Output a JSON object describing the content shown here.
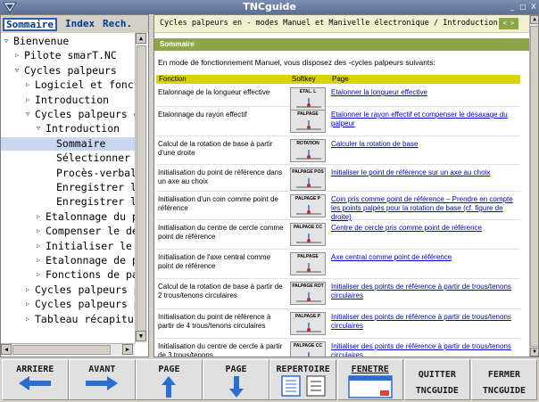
{
  "window": {
    "title": "TNCguide",
    "controls": [
      "_",
      "□",
      "X"
    ]
  },
  "tabs": [
    {
      "label": "Sommaire",
      "active": true
    },
    {
      "label": "Index",
      "active": false
    },
    {
      "label": "Rech.",
      "active": false
    }
  ],
  "tree": [
    {
      "label": "Bienvenue",
      "indent": 0,
      "arrow": "▽"
    },
    {
      "label": "Pilote smarT.NC",
      "indent": 1,
      "arrow": "▷"
    },
    {
      "label": "Cycles palpeurs",
      "indent": 1,
      "arrow": "▽"
    },
    {
      "label": "Logiciel et fonct",
      "indent": 2,
      "arrow": "▷"
    },
    {
      "label": "Introduction",
      "indent": 2,
      "arrow": "▷"
    },
    {
      "label": "Cycles palpeurs e",
      "indent": 2,
      "arrow": "▽"
    },
    {
      "label": "Introduction",
      "indent": 3,
      "arrow": "▽"
    },
    {
      "label": "Sommaire",
      "indent": 4,
      "arrow": "",
      "selected": true
    },
    {
      "label": "Sélectionner l",
      "indent": 4,
      "arrow": ""
    },
    {
      "label": "Procès-verbal",
      "indent": 4,
      "arrow": ""
    },
    {
      "label": "Enregistrer le",
      "indent": 4,
      "arrow": ""
    },
    {
      "label": "Enregistrer le",
      "indent": 4,
      "arrow": ""
    },
    {
      "label": "Etalonnage du p",
      "indent": 3,
      "arrow": "▷"
    },
    {
      "label": "Compenser le dé",
      "indent": 3,
      "arrow": "▷"
    },
    {
      "label": "Initialiser le p",
      "indent": 3,
      "arrow": "▷"
    },
    {
      "label": "Etalonnage de p",
      "indent": 3,
      "arrow": "▷"
    },
    {
      "label": "Fonctions de pa",
      "indent": 3,
      "arrow": "▷"
    },
    {
      "label": "Cycles palpeurs p",
      "indent": 2,
      "arrow": "▷"
    },
    {
      "label": "Cycles palpeurs p",
      "indent": 2,
      "arrow": "▷"
    },
    {
      "label": "Tableau récapitul",
      "indent": 2,
      "arrow": "▷"
    }
  ],
  "breadcrumb": "Cycles palpeurs en - modes Manuel et Manivelle électronique / Introduction",
  "nav_arrows": "< >",
  "section_title": "Sommaire",
  "intro": "En mode de fonctionnement Manuel, vous disposez des -cycles palpeurs suivants:",
  "table": {
    "headers": [
      "Fonction",
      "Softkey",
      "Page"
    ],
    "rows": [
      {
        "fn": "Etalonnage de la longueur effective",
        "softkey": "ETAL. L",
        "page": "Etalonner la longueur effective"
      },
      {
        "fn": "Etalonnage du rayon effectif",
        "softkey": "PALPAGE",
        "page": "Etalonner le rayon effectif et compenser le désaxage du palpeur"
      },
      {
        "fn": "Calcul de la rotation de base à partir d'une droite",
        "softkey": "ROTATION",
        "page": "Calculer la rotation de base"
      },
      {
        "fn": "Initialisation du point de référence dans un axe au choix",
        "softkey": "PALPAGE POS",
        "page": "Initialiser le point de référence sur un axe au choix"
      },
      {
        "fn": "Initialisation d'un coin comme point de référence",
        "softkey": "PALPAGE P",
        "page": "Coin pris comme point de référence – Prendre en compte les points palpés pour la rotation de base (cf. figure de droite)"
      },
      {
        "fn": "Initialisation du centre de cercle comme point de référence",
        "softkey": "PALPAGE CC",
        "page": "Centre de cercle pris comme point de référence"
      },
      {
        "fn": "Initialisation de l'axe central comme point de référence",
        "softkey": "PALPAGE",
        "page": "Axe central comme point de référence"
      },
      {
        "fn": "Calcul de la rotation de base à partir de 2 trous/tenons circulaires",
        "softkey": "PALPAGE ROT",
        "page": "Initialiser des points de référence à partir de trous/tenons circulaires"
      },
      {
        "fn": "Initialisation du point de référence à partir de 4 trous/tenons circulaires",
        "softkey": "PALPAGE P",
        "page": "Initialiser des points de référence à partir de trous/tenons circulaires"
      },
      {
        "fn": "Initialisation du centre de cercle à partir de 3 trous/tenons",
        "softkey": "PALPAGE CC",
        "page": "Initialiser des points de référence à partir de trous/tenons circulaires"
      }
    ]
  },
  "softkeys": [
    {
      "label": "ARRIERE",
      "label2": "",
      "icon": "arrow-left-icon"
    },
    {
      "label": "AVANT",
      "label2": "",
      "icon": "arrow-right-icon"
    },
    {
      "label": "PAGE",
      "label2": "",
      "icon": "arrow-up-icon"
    },
    {
      "label": "PAGE",
      "label2": "",
      "icon": "arrow-down-icon"
    },
    {
      "label": "REPERTOIRE",
      "label2": "",
      "icon": "toc-icon"
    },
    {
      "label": "FENETRE",
      "label2": "",
      "icon": "window-icon"
    },
    {
      "label": "QUITTER",
      "label2": "TNCGUIDE",
      "icon": ""
    },
    {
      "label": "FERMER",
      "label2": "TNCGUIDE",
      "icon": ""
    }
  ],
  "colors": {
    "accent_green": "#8da64a",
    "header_yellow": "#d9d400",
    "link_blue": "#0000cc",
    "icon_blue": "#2a6fd0"
  }
}
